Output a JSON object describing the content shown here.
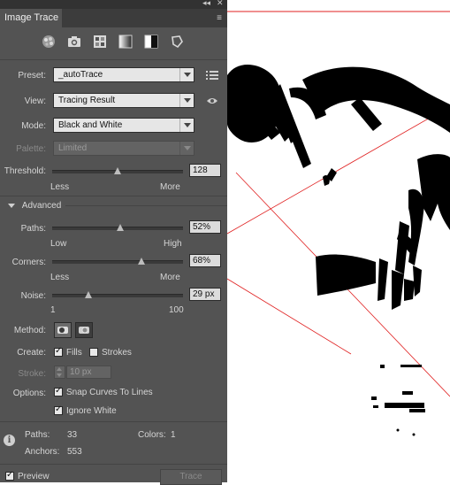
{
  "panel": {
    "title": "Image Trace",
    "preset": {
      "label": "Preset:",
      "value": "_autoTrace"
    },
    "view": {
      "label": "View:",
      "value": "Tracing Result"
    },
    "mode": {
      "label": "Mode:",
      "value": "Black and White"
    },
    "palette": {
      "label": "Palette:",
      "value": "Limited"
    },
    "threshold": {
      "label": "Threshold:",
      "value": "128",
      "level": 0.5,
      "min_label": "Less",
      "max_label": "More"
    },
    "advanced_label": "Advanced",
    "paths": {
      "label": "Paths:",
      "value": "52%",
      "level": 0.52,
      "min_label": "Low",
      "max_label": "High"
    },
    "corners": {
      "label": "Corners:",
      "value": "68%",
      "level": 0.68,
      "min_label": "Less",
      "max_label": "More"
    },
    "noise": {
      "label": "Noise:",
      "value": "29 px",
      "level": 0.28,
      "min_label": "1",
      "max_label": "100"
    },
    "method": {
      "label": "Method:"
    },
    "create": {
      "label": "Create:",
      "fills_label": "Fills",
      "fills_checked": true,
      "strokes_label": "Strokes",
      "strokes_checked": false
    },
    "stroke": {
      "label": "Stroke:",
      "value": "10 px"
    },
    "options": {
      "label": "Options:",
      "snap_label": "Snap Curves To Lines",
      "snap_checked": true,
      "ignore_label": "Ignore White",
      "ignore_checked": true
    },
    "stats": {
      "paths_label": "Paths:",
      "paths_value": "33",
      "colors_label": "Colors:",
      "colors_value": "1",
      "anchors_label": "Anchors:",
      "anchors_value": "553"
    },
    "preview": {
      "label": "Preview",
      "checked": true
    },
    "trace_label": "Trace",
    "preset_icons": [
      "auto-color-icon",
      "high-color-icon",
      "low-color-icon",
      "grayscale-icon",
      "black-and-white-icon",
      "outline-icon"
    ]
  },
  "colors": {
    "panel_bg": "#535353",
    "canvas_bg": "#ffffff",
    "trace_fill": "#000000",
    "guide_line": "#e02020"
  }
}
